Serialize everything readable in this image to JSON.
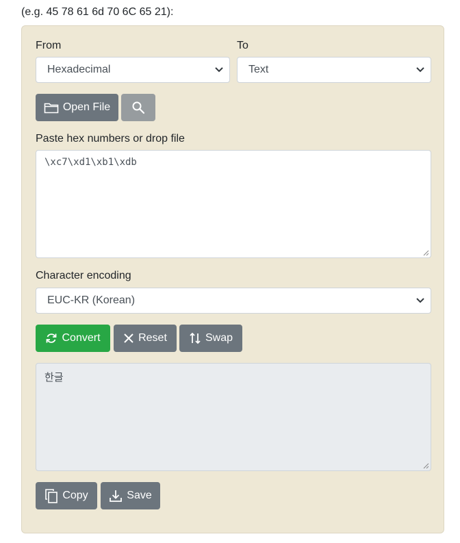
{
  "hint_text": "(e.g. 45 78 61 6d 70 6C 65 21):",
  "from": {
    "label": "From",
    "selected": "Hexadecimal"
  },
  "to": {
    "label": "To",
    "selected": "Text"
  },
  "file_buttons": {
    "open_file": "Open File"
  },
  "input": {
    "label": "Paste hex numbers or drop file",
    "value": "\\xc7\\xd1\\xb1\\xdb"
  },
  "encoding": {
    "label": "Character encoding",
    "selected": "EUC-KR (Korean)"
  },
  "actions": {
    "convert": "Convert",
    "reset": "Reset",
    "swap": "Swap"
  },
  "output": {
    "value": "한글"
  },
  "output_actions": {
    "copy": "Copy",
    "save": "Save"
  },
  "colors": {
    "panel_bg": "#eee8d5",
    "button_gray": "#6c757d",
    "button_green": "#28a745",
    "output_bg": "#e9ecef"
  },
  "icons": [
    "folder-icon",
    "search-icon",
    "refresh-icon",
    "close-icon",
    "swap-icon",
    "copy-icon",
    "download-icon",
    "chevron-down-icon"
  ]
}
